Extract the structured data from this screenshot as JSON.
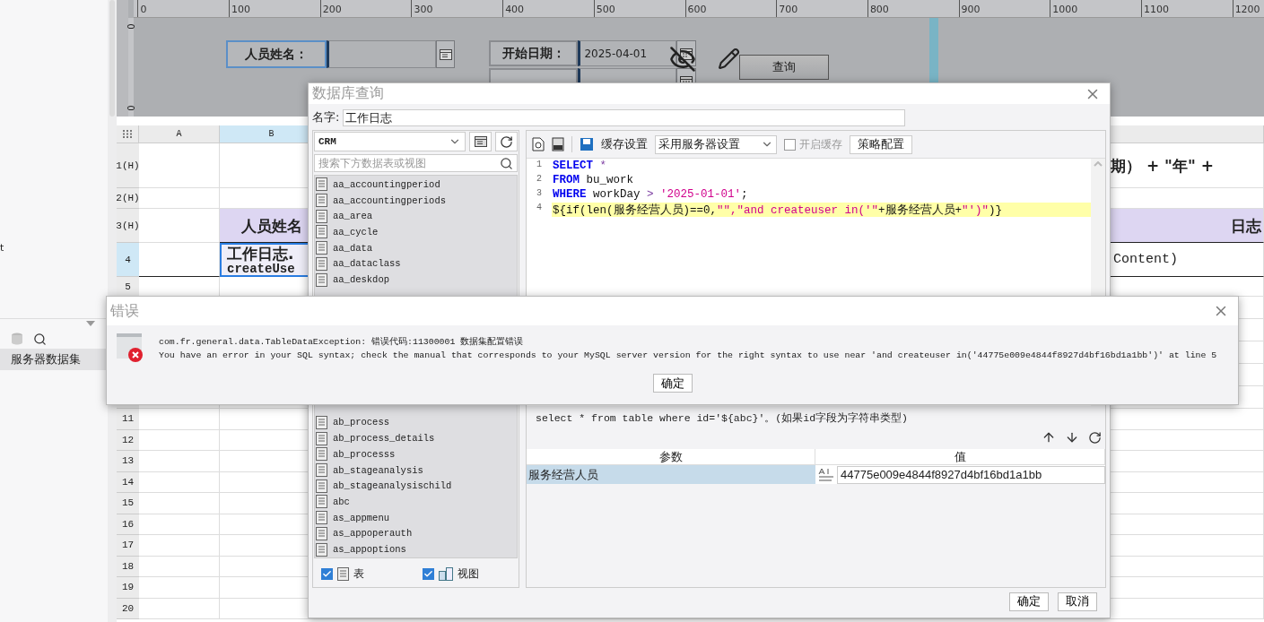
{
  "left_panel": {
    "partial_text": "t",
    "items": [
      {
        "label": "服务器数据集",
        "selected": true
      }
    ]
  },
  "designer": {
    "ruler_labels": [
      "0",
      "100",
      "200",
      "300",
      "400",
      "500",
      "600",
      "700",
      "800",
      "900",
      "1000",
      "1100",
      "1200"
    ],
    "vruler_labels": [
      "0",
      "0"
    ],
    "name_label": "人员姓名：",
    "start_label": "开始日期：",
    "start_value": "2025-04-01",
    "query_button": "查询"
  },
  "sheet": {
    "columns": [
      {
        "label": "A",
        "selected": false
      },
      {
        "label": "B",
        "selected": true
      }
    ],
    "rows_top": [
      {
        "label": "1(H)",
        "selected": false
      },
      {
        "label": "2(H)",
        "selected": false
      },
      {
        "label": "3(H)",
        "selected": false
      },
      {
        "label": "4",
        "selected": true
      },
      {
        "label": "5",
        "selected": false
      }
    ],
    "rows_bottom": [
      {
        "label": "11",
        "selected": false
      },
      {
        "label": "12",
        "selected": false
      },
      {
        "label": "13",
        "selected": false
      },
      {
        "label": "14",
        "selected": false
      },
      {
        "label": "15",
        "selected": false
      },
      {
        "label": "16",
        "selected": false
      },
      {
        "label": "17",
        "selected": false
      },
      {
        "label": "18",
        "selected": false
      },
      {
        "label": "19",
        "selected": false
      },
      {
        "label": "20",
        "selected": false
      }
    ],
    "b3": "人员姓名",
    "b4_line1": "工作日志.",
    "b4_line2": "createUse",
    "right_r1": "期） + \"年\" +",
    "right_r3": "日志",
    "right_r4": "Content)"
  },
  "query_dialog": {
    "title": "数据库查询",
    "name_label": "名字:",
    "name_value": "工作日志",
    "connection": "CRM",
    "search_placeholder": "搜索下方数据表或视图",
    "tables_top": [
      "aa_accountingperiod",
      "aa_accountingperiods",
      "aa_area",
      "aa_cycle",
      "aa_data",
      "aa_dataclass",
      "aa_deskdop"
    ],
    "tables_bottom": [
      "ab_process",
      "ab_process_details",
      "ab_processs",
      "ab_stageanalysis",
      "ab_stageanalysischild",
      "abc",
      "as_appmenu",
      "as_appoperauth",
      "as_appoptions"
    ],
    "filters": [
      {
        "label": "表",
        "checked": true,
        "kind": "table"
      },
      {
        "label": "视图",
        "checked": true,
        "kind": "view"
      }
    ],
    "cache_label": "缓存设置",
    "cache_mode": "采用服务器设置",
    "enable_cache": {
      "label": "开启缓存",
      "checked": false,
      "disabled": true
    },
    "strategy_button": "策略配置",
    "code_lines": [
      {
        "number": "1",
        "highlighted": false,
        "tokens": [
          {
            "text": "SELECT ",
            "kind": "keyword"
          },
          {
            "text": "*",
            "kind": "operator"
          }
        ]
      },
      {
        "number": "2",
        "highlighted": false,
        "tokens": [
          {
            "text": "FROM ",
            "kind": "keyword"
          },
          {
            "text": "bu_work",
            "kind": "plain"
          }
        ]
      },
      {
        "number": "3",
        "highlighted": false,
        "tokens": [
          {
            "text": "WHERE ",
            "kind": "keyword"
          },
          {
            "text": "workDay ",
            "kind": "plain"
          },
          {
            "text": "> ",
            "kind": "operator"
          },
          {
            "text": "'2025-01-01'",
            "kind": "string"
          },
          {
            "text": ";",
            "kind": "plain"
          }
        ]
      },
      {
        "number": "4",
        "highlighted": true,
        "tokens": [
          {
            "text": "${if(len(服务经营人员)==0,",
            "kind": "plain"
          },
          {
            "text": "\"\",\"and createuser in('\"",
            "kind": "string"
          },
          {
            "text": "+服务经营人员+",
            "kind": "plain"
          },
          {
            "text": "\"')\"",
            "kind": "string"
          },
          {
            "text": ")}",
            "kind": "plain"
          }
        ]
      }
    ],
    "hint": "select * from table where id='${abc}'。(如果id字段为字符串类型)",
    "param_columns": [
      "参数",
      "值"
    ],
    "params": [
      {
        "name": "服务经营人员",
        "value": "44775e009e4844f8927d4bf16bd1a1bb",
        "selected": true
      }
    ],
    "buttons": [
      "确定",
      "取消"
    ]
  },
  "error_dialog": {
    "title": "错误",
    "lines": [
      "com.fr.general.data.TableDataException: 错误代码:11300001 数据集配置错误",
      "You have an error in your SQL syntax; check the manual that corresponds to your MySQL server version for the right syntax to use near 'and createuser in('44775e009e4844f8927d4bf16bd1a1bb')' at line 5"
    ],
    "button": "确定"
  }
}
